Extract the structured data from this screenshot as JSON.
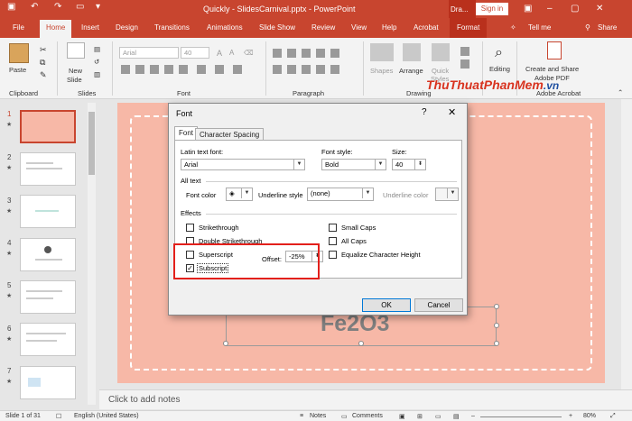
{
  "title_bar": {
    "title": "Quickly - SlidesCarnival.pptx - PowerPoint",
    "drawing_context": "Dra...",
    "sign_in": "Sign in"
  },
  "tabs": [
    "File",
    "Home",
    "Insert",
    "Design",
    "Transitions",
    "Animations",
    "Slide Show",
    "Review",
    "View",
    "Help",
    "Acrobat",
    "Format",
    "Tell me",
    "Share"
  ],
  "ribbon": {
    "paste": "Paste",
    "new_slide_1": "New",
    "new_slide_2": "Slide",
    "font_name": "Arial",
    "font_size": "40",
    "shapes": "Shapes",
    "arrange": "Arrange",
    "quick_styles_1": "Quick",
    "quick_styles_2": "Styles",
    "editing": "Editing",
    "create_share_1": "Create and Share",
    "create_share_2": "Adobe PDF",
    "groups": {
      "clipboard": "Clipboard",
      "slides": "Slides",
      "font": "Font",
      "paragraph": "Paragraph",
      "drawing": "Drawing",
      "adobe": "Adobe Acrobat"
    }
  },
  "thumbnails": [
    {
      "num": "1"
    },
    {
      "num": "2"
    },
    {
      "num": "3"
    },
    {
      "num": "4"
    },
    {
      "num": "5"
    },
    {
      "num": "6"
    },
    {
      "num": "7"
    }
  ],
  "slide": {
    "text_main": "Fe2O3"
  },
  "notes_placeholder": "Click to add notes",
  "status": {
    "slide_info": "Slide 1 of 31",
    "language": "English (United States)",
    "notes": "Notes",
    "comments": "Comments",
    "zoom": "80%"
  },
  "dialog": {
    "title": "Font",
    "help": "?",
    "close": "✕",
    "tabs": [
      "Font",
      "Character Spacing"
    ],
    "latin_font_label": "Latin text font:",
    "latin_font_value": "Arial",
    "font_style_label": "Font style:",
    "font_style_value": "Bold",
    "size_label": "Size:",
    "size_value": "40",
    "all_text_label": "All text",
    "font_color_label": "Font color",
    "underline_style_label": "Underline style",
    "underline_style_value": "(none)",
    "underline_color_label": "Underline color",
    "effects_label": "Effects",
    "effects": {
      "strikethrough": {
        "label": "Strikethrough",
        "checked": false
      },
      "double_strikethrough": {
        "label": "Double Strikethrough",
        "checked": false
      },
      "superscript": {
        "label": "Superscript",
        "checked": false
      },
      "subscript": {
        "label": "Subscript",
        "checked": true
      },
      "small_caps": {
        "label": "Small Caps",
        "checked": false
      },
      "all_caps": {
        "label": "All Caps",
        "checked": false
      },
      "equalize_height": {
        "label": "Equalize Character Height",
        "checked": false
      }
    },
    "offset_label": "Offset:",
    "offset_value": "-25%",
    "ok": "OK",
    "cancel": "Cancel"
  },
  "watermark": {
    "text": "ThuThuatPhanMem",
    "tld": ".vn"
  },
  "colors": {
    "accent": "#c8452f",
    "slide_bg": "#f7b8a7",
    "highlight_box": "#e3201b"
  }
}
